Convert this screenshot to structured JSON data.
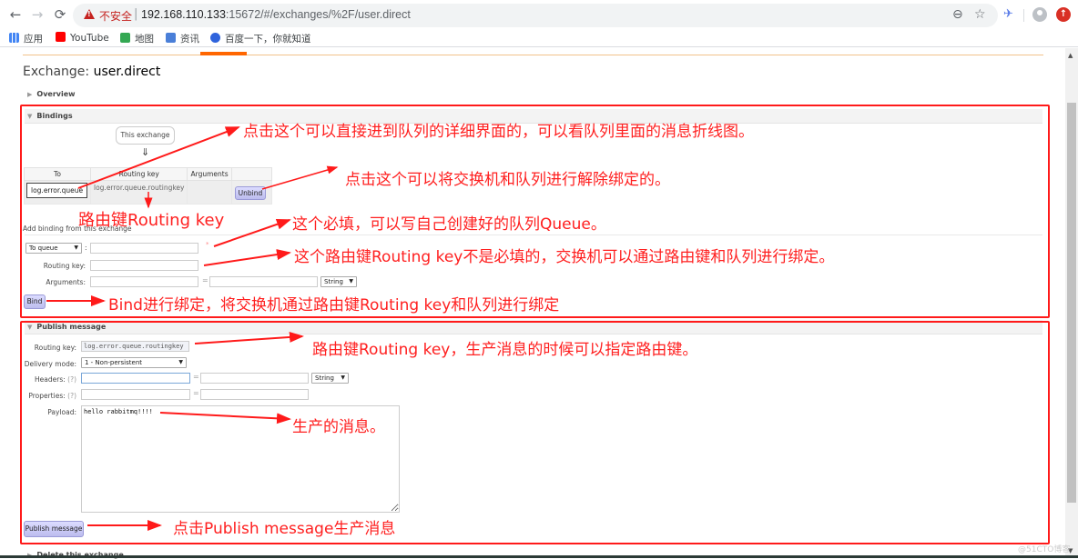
{
  "browser": {
    "security_label": "不安全",
    "url_host": "192.168.110.133",
    "url_rest": ":15672/#/exchanges/%2F/user.direct",
    "nav": {
      "back": "←",
      "forward": "→",
      "reload": "C"
    },
    "icons": {
      "zoom": "zoom-out-icon",
      "star": "bookmark-star-icon",
      "extension": "bird-extension-icon",
      "profile": "profile-avatar-icon",
      "update": "update-icon"
    },
    "update_glyph": "↑",
    "bookmarks": [
      {
        "label": "应用",
        "color": "#4285f4"
      },
      {
        "label": "YouTube",
        "color": "#ff0000"
      },
      {
        "label": "地图",
        "color": "#34a853"
      },
      {
        "label": "资讯",
        "color": "#4a7fd8"
      },
      {
        "label": "百度一下，你就知道",
        "color": "#2e63dc"
      }
    ]
  },
  "page": {
    "title_prefix": "Exchange: ",
    "title_name": "user.direct",
    "sections": {
      "overview": "Overview",
      "bindings": "Bindings",
      "publish": "Publish message",
      "delete": "Delete this exchange"
    },
    "bindings": {
      "this_exchange": "This exchange",
      "down_arrow": "⇓",
      "columns": [
        "To",
        "Routing key",
        "Arguments",
        ""
      ],
      "rows": [
        {
          "to": "log.error.queue",
          "routing_key": "log.error.queue.routingkey",
          "arguments": "",
          "action": "Unbind"
        }
      ],
      "add_title": "Add binding from this exchange",
      "destination_type": "To queue",
      "destination_value": "",
      "required_mark": "*",
      "routing_key_label": "Routing key:",
      "routing_key_value": "",
      "arguments_label": "Arguments:",
      "arg_key": "",
      "arg_value": "",
      "arg_type": "String",
      "bind_button": "Bind"
    },
    "publish": {
      "routing_key_label": "Routing key:",
      "routing_key_value": "log.error.queue.routingkey",
      "delivery_mode_label": "Delivery mode:",
      "delivery_mode_value": "1 - Non-persistent",
      "headers_label": "Headers:",
      "headers_help": "(?)",
      "header_key": "",
      "header_value": "",
      "header_type": "String",
      "properties_label": "Properties:",
      "properties_help": "(?)",
      "property_key": "",
      "property_value": "",
      "payload_label": "Payload:",
      "payload_value": "hello rabbitmq!!!!",
      "publish_button": "Publish message"
    },
    "equals": "="
  },
  "annotations": {
    "queue_link": "点击这个可以直接进到队列的详细界面的，可以看队列里面的消息折线图。",
    "unbind": "点击这个可以将交换机和队列进行解除绑定的。",
    "routing_key": "路由键Routing key",
    "required_queue": "这个必填，可以写自己创建好的队列Queue。",
    "optional_routing": "这个路由键Routing key不是必填的，交换机可以通过路由键和队列进行绑定。",
    "bind": "Bind进行绑定，将交换机通过路由键Routing key和队列进行绑定",
    "publish_routing": "路由键Routing key，生产消息的时候可以指定路由键。",
    "payload": "生产的消息。",
    "publish_button": "点击Publish message生产消息",
    "color": "#ff2020"
  },
  "watermark": "@51CTO博客"
}
